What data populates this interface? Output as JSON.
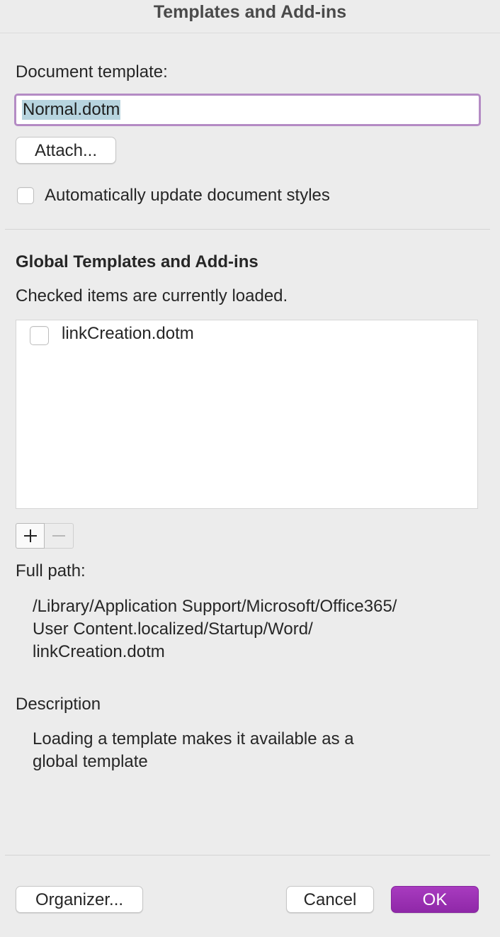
{
  "window": {
    "title": "Templates and Add-ins"
  },
  "document_template": {
    "label": "Document template:",
    "value": "Normal.dotm",
    "attach_label": "Attach...",
    "auto_update_label": "Automatically update document styles",
    "auto_update_checked": false
  },
  "global": {
    "heading": "Global Templates and Add-ins",
    "hint": "Checked items are currently loaded.",
    "items": [
      {
        "name": "linkCreation.dotm",
        "checked": false
      }
    ],
    "add_icon": "plus-icon",
    "remove_icon": "minus-icon"
  },
  "full_path": {
    "label": "Full path:",
    "lines": [
      "/Library/Application Support/Microsoft/Office365/",
      "User Content.localized/Startup/Word/",
      "linkCreation.dotm"
    ]
  },
  "description": {
    "label": "Description",
    "lines": [
      "Loading a template makes it available as a",
      "global template"
    ]
  },
  "footer": {
    "organizer_label": "Organizer...",
    "cancel_label": "Cancel",
    "ok_label": "OK"
  },
  "colors": {
    "accent": "#9b30b4",
    "focus_ring": "#b48bc4",
    "selection": "#b7d4df"
  }
}
